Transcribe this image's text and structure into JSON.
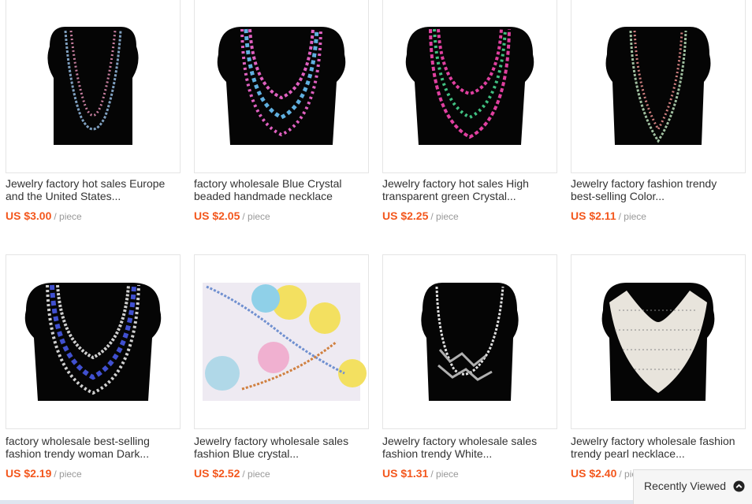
{
  "products": [
    {
      "title": "Jewelry factory hot sales Europe\nand the United States...",
      "price": "US $3.00",
      "unit": "/ piece"
    },
    {
      "title": "factory wholesale Blue Crystal\nbeaded handmade necklace",
      "price": "US $2.05",
      "unit": "/ piece"
    },
    {
      "title": "Jewelry factory hot sales High\ntransparent green Crystal...",
      "price": "US $2.25",
      "unit": "/ piece"
    },
    {
      "title": "Jewelry factory fashion trendy\nbest-selling Color...",
      "price": "US $2.11",
      "unit": "/ piece"
    },
    {
      "title": "factory wholesale best-selling\nfashion trendy woman Dark...",
      "price": "US $2.19",
      "unit": "/ piece"
    },
    {
      "title": "Jewelry factory wholesale sales\nfashion Blue crystal...",
      "price": "US $2.52",
      "unit": "/ piece"
    },
    {
      "title": "Jewelry factory wholesale sales\nfashion trendy White...",
      "price": "US $1.31",
      "unit": "/ piece"
    },
    {
      "title": "Jewelry factory wholesale fashion\ntrendy pearl necklace...",
      "price": "US $2.40",
      "unit": "/ piece"
    }
  ],
  "recently_viewed": {
    "label": "Recently Viewed",
    "icon": "chevron-up-circle-icon"
  },
  "colors": {
    "price": "#f3571d",
    "border": "#e5e5e5",
    "text": "#333333",
    "muted": "#999999"
  }
}
